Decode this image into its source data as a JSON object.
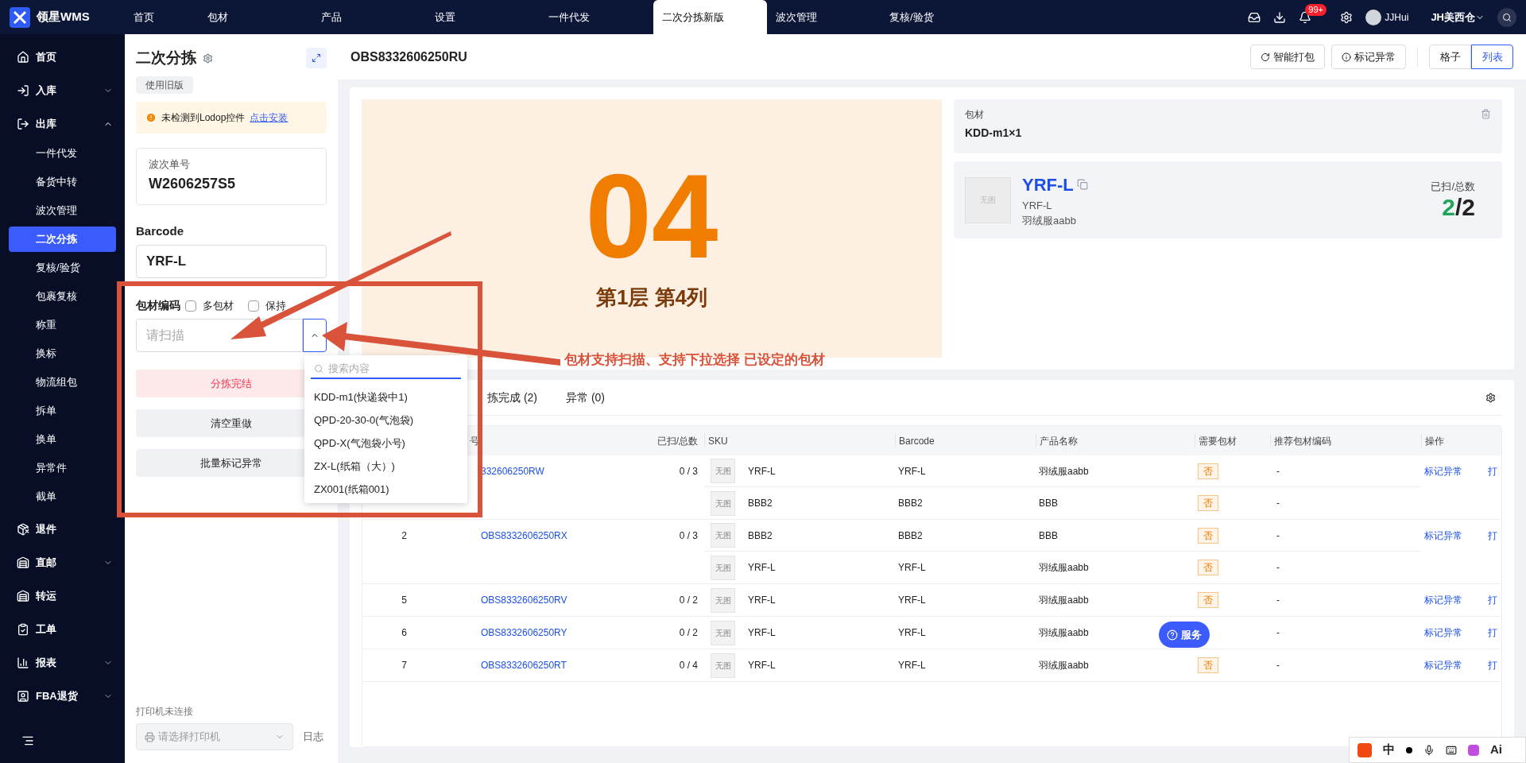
{
  "app": {
    "logo": "领星WMS"
  },
  "nav_tabs": [
    {
      "label": "首页",
      "selected": false
    },
    {
      "label": "包材",
      "selected": false
    },
    {
      "label": "产品",
      "selected": false
    },
    {
      "label": "设置",
      "selected": false
    },
    {
      "label": "一件代发",
      "selected": false
    },
    {
      "label": "二次分拣新版",
      "selected": true
    },
    {
      "label": "波次管理",
      "selected": false
    },
    {
      "label": "复核/验货",
      "selected": false
    }
  ],
  "header_right": {
    "badge": "99+",
    "user": "JJHui",
    "warehouse": "JH美西仓"
  },
  "sidebar": {
    "items": [
      {
        "label": "首页"
      },
      {
        "label": "入库",
        "expanded": false
      },
      {
        "label": "出库",
        "expanded": true,
        "children": [
          {
            "label": "一件代发",
            "selected": false
          },
          {
            "label": "备货中转",
            "selected": false
          },
          {
            "label": "波次管理",
            "selected": false
          },
          {
            "label": "二次分拣",
            "selected": true
          },
          {
            "label": "复核/验货",
            "selected": false
          },
          {
            "label": "包裹复核",
            "selected": false
          },
          {
            "label": "称重",
            "selected": false
          },
          {
            "label": "换标",
            "selected": false
          },
          {
            "label": "物流组包",
            "selected": false
          },
          {
            "label": "拆单",
            "selected": false
          },
          {
            "label": "换单",
            "selected": false
          },
          {
            "label": "异常件",
            "selected": false
          },
          {
            "label": "截单",
            "selected": false
          }
        ]
      },
      {
        "label": "退件"
      },
      {
        "label": "直邮",
        "expanded": false
      },
      {
        "label": "转运"
      },
      {
        "label": "工单"
      },
      {
        "label": "报表",
        "expanded": false
      },
      {
        "label": "FBA退货",
        "expanded": false
      }
    ]
  },
  "panel": {
    "title": "二次分拣",
    "old_version": "使用旧版",
    "alert": {
      "text": "未检测到Lodop控件",
      "link": "点击安装"
    },
    "wave": {
      "label": "波次单号",
      "value": "W2606257S5"
    },
    "barcode": {
      "label": "Barcode",
      "value": "YRF-L"
    },
    "packaging": {
      "label": "包材编码",
      "options": [
        {
          "label": "多包材",
          "checked": false
        },
        {
          "label": "保持",
          "checked": false
        }
      ],
      "placeholder": "请扫描",
      "expanded": true
    },
    "buttons": [
      {
        "label": "分拣完结",
        "kind": "danger"
      },
      {
        "label": "清空重做",
        "kind": "plain"
      },
      {
        "label": "批量标记异常",
        "kind": "plain"
      }
    ],
    "printer": {
      "status": "打印机未连接",
      "placeholder": "请选择打印机"
    },
    "log": "日志"
  },
  "dropdown": {
    "placeholder": "搜索内容",
    "options": [
      "KDD-m1(快递袋中1)",
      "QPD-20-30-0(气泡袋)",
      "QPD-X(气泡袋小号)",
      "ZX-L(纸箱（大）)",
      "ZX001(纸箱001)"
    ]
  },
  "order": {
    "title": "OBS8332606250RU",
    "buttons": [
      "智能打包",
      "标记异常"
    ],
    "views": [
      {
        "label": "格子",
        "selected": false
      },
      {
        "label": "列表",
        "selected": true
      }
    ]
  },
  "slot": {
    "number": "04",
    "position": "第1层 第4列"
  },
  "packaging_card": {
    "label": "包材",
    "value": "KDD-m1×1"
  },
  "product_card": {
    "sku": "YRF-L",
    "image": "无图",
    "barcode": "YRF-L",
    "name": "羽绒服aabb",
    "progress_label": "已扫/总数",
    "scanned": "2",
    "separator": "/",
    "total": "2"
  },
  "table": {
    "tabs": [
      {
        "label": "拣完成 (2)",
        "selected": false
      },
      {
        "label": "异常 (0)",
        "selected": false
      }
    ],
    "columns": [
      "号",
      "已扫/总数",
      "SKU",
      "Barcode",
      "产品名称",
      "需要包材",
      "推荐包材编码",
      "操作"
    ],
    "orders": [
      {
        "order_no": "332606250RW",
        "scanned": "0 / 3",
        "action": "标记异常",
        "print": "打",
        "items": [
          {
            "image": "无图",
            "sku": "YRF-L",
            "barcode": "YRF-L",
            "name": "羽绒服aabb",
            "need": "否",
            "rec": "-"
          },
          {
            "image": "无图",
            "sku": "BBB2",
            "barcode": "BBB2",
            "name": "BBB",
            "need": "否",
            "rec": "-"
          }
        ]
      },
      {
        "index": "2",
        "order_no": "OBS8332606250RX",
        "scanned": "0 / 3",
        "action": "标记异常",
        "print": "打",
        "items": [
          {
            "image": "无图",
            "sku": "BBB2",
            "barcode": "BBB2",
            "name": "BBB",
            "need": "否",
            "rec": "-"
          },
          {
            "image": "无图",
            "sku": "YRF-L",
            "barcode": "YRF-L",
            "name": "羽绒服aabb",
            "need": "否",
            "rec": "-"
          }
        ]
      },
      {
        "index": "5",
        "order_no": "OBS8332606250RV",
        "scanned": "0 / 2",
        "action": "标记异常",
        "print": "打",
        "items": [
          {
            "image": "无图",
            "sku": "YRF-L",
            "barcode": "YRF-L",
            "name": "羽绒服aabb",
            "need": "否",
            "rec": "-"
          }
        ]
      },
      {
        "index": "6",
        "order_no": "OBS8332606250RY",
        "scanned": "0 / 2",
        "action": "标记异常",
        "print": "打",
        "items": [
          {
            "image": "无图",
            "sku": "YRF-L",
            "barcode": "YRF-L",
            "name": "羽绒服aabb",
            "rec": "-"
          }
        ]
      },
      {
        "index": "7",
        "order_no": "OBS8332606250RT",
        "scanned": "0 / 4",
        "action": "标记异常",
        "print": "打",
        "items": [
          {
            "image": "无图",
            "sku": "YRF-L",
            "barcode": "YRF-L",
            "name": "羽绒服aabb",
            "need": "否",
            "rec": "-"
          }
        ]
      }
    ]
  },
  "annotation": {
    "text": "包材支持扫描、支持下拉选择 已设定的包材"
  },
  "service_button": "服务",
  "ime_toolbar": {
    "mode": "中",
    "ai": "Ai"
  }
}
